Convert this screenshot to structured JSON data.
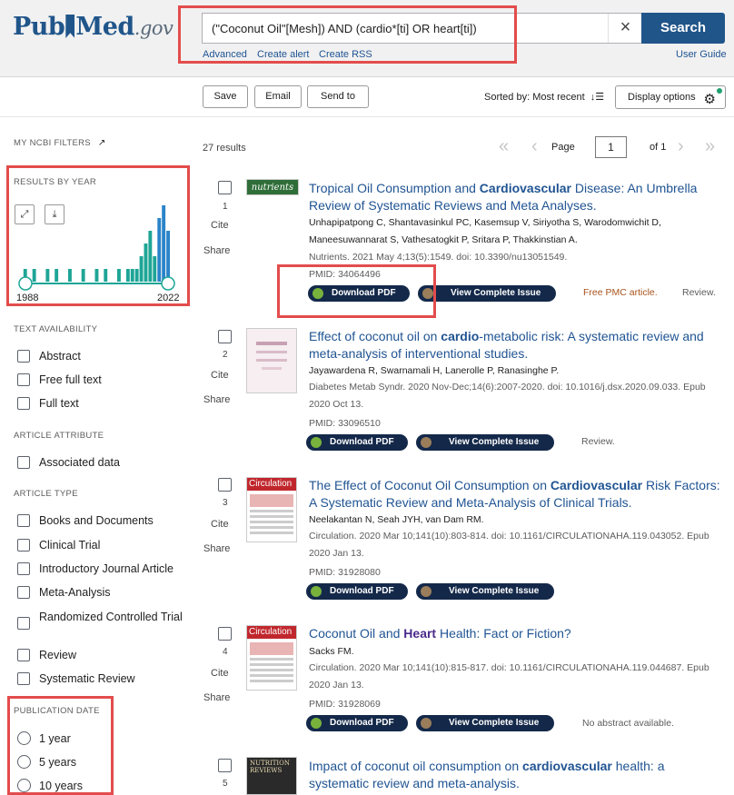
{
  "header": {
    "logo_main_a": "Pub",
    "logo_main_b": "Med",
    "logo_gov": ".gov",
    "query": "(\"Coconut Oil\"[Mesh]) AND (cardio*[ti] OR heart[ti])",
    "clear_icon": "×",
    "search_label": "Search",
    "links": {
      "advanced": "Advanced",
      "create_alert": "Create alert",
      "create_rss": "Create RSS",
      "user_guide": "User Guide"
    }
  },
  "toolbar": {
    "save": "Save",
    "email": "Email",
    "send_to": "Send to",
    "sorted_by": "Sorted by: Most recent",
    "sort_icon": "↓☰",
    "display_options": "Display options",
    "gear_icon": "⚙"
  },
  "sidebar": {
    "my_ncbi_filters": "MY NCBI FILTERS",
    "results_by_year": "RESULTS BY YEAR",
    "expand_icon": "⤢",
    "download_icon": "⤓",
    "year_start": "1988",
    "year_end": "2022",
    "text_availability": {
      "heading": "TEXT AVAILABILITY",
      "items": [
        "Abstract",
        "Free full text",
        "Full text"
      ]
    },
    "article_attribute": {
      "heading": "ARTICLE ATTRIBUTE",
      "items": [
        "Associated data"
      ]
    },
    "article_type": {
      "heading": "ARTICLE TYPE",
      "items": [
        "Books and Documents",
        "Clinical Trial",
        "Introductory Journal Article",
        "Meta-Analysis",
        "Randomized Controlled Trial",
        "Review",
        "Systematic Review"
      ]
    },
    "publication_date": {
      "heading": "PUBLICATION DATE",
      "items": [
        "1 year",
        "5 years",
        "10 years"
      ]
    }
  },
  "chart_data": {
    "type": "bar",
    "title": "RESULTS BY YEAR",
    "x_range": [
      "1988",
      "2022"
    ],
    "values": [
      0,
      0,
      1,
      0,
      1,
      0,
      0,
      1,
      0,
      1,
      0,
      0,
      1,
      0,
      0,
      1,
      0,
      0,
      1,
      0,
      1,
      0,
      0,
      1,
      0,
      1,
      1,
      1,
      2,
      3,
      4,
      2,
      5,
      6,
      4
    ]
  },
  "results": {
    "count": "27 results",
    "page_label": "Page",
    "page_value": "1",
    "of_pages": "of 1",
    "cite": "Cite",
    "share": "Share",
    "download_pdf": "Download PDF",
    "view_issue": "View Complete Issue",
    "items": [
      {
        "num": "1",
        "thumb_label": "nutrients",
        "title_a": "Tropical Oil Consumption and ",
        "title_b": "Cardiovascular",
        "title_c": " Disease: An Umbrella Review of Systematic Reviews and Meta Analyses.",
        "authors": "Unhapipatpong C, Shantavasinkul PC, Kasemsup V, Siriyotha S, Warodomwichit D, Maneesuwannarat S, Vathesatogkit P, Sritara P, Thakkinstian A.",
        "citation": "Nutrients. 2021 May 4;13(5):1549. doi: 10.3390/nu13051549.",
        "pmid": "PMID: 34064496",
        "free_pmc": "Free PMC article.",
        "tag": "Review."
      },
      {
        "num": "2",
        "title_a": "Effect of coconut oil on ",
        "title_b": "cardio",
        "title_c": "-metabolic risk: A systematic review and meta-analysis of interventional studies.",
        "authors": "Jayawardena R, Swarnamali H, Lanerolle P, Ranasinghe P.",
        "citation": "Diabetes Metab Syndr. 2020 Nov-Dec;14(6):2007-2020. doi: 10.1016/j.dsx.2020.09.033. Epub 2020 Oct 13.",
        "pmid": "PMID: 33096510",
        "tag": "Review."
      },
      {
        "num": "3",
        "thumb_label": "Circulation",
        "title_a": "The Effect of Coconut Oil Consumption on ",
        "title_b": "Cardiovascular",
        "title_c": " Risk Factors: A Systematic Review and Meta-Analysis of Clinical Trials.",
        "authors": "Neelakantan N, Seah JYH, van Dam RM.",
        "citation": "Circulation. 2020 Mar 10;141(10):803-814. doi: 10.1161/CIRCULATIONAHA.119.043052. Epub 2020 Jan 13.",
        "pmid": "PMID: 31928080"
      },
      {
        "num": "4",
        "thumb_label": "Circulation",
        "title_a": "Coconut Oil and ",
        "title_b": "Heart",
        "title_c": " Health: Fact or Fiction?",
        "authors": "Sacks FM.",
        "citation": "Circulation. 2020 Mar 10;141(10):815-817. doi: 10.1161/CIRCULATIONAHA.119.044687. Epub 2020 Jan 13.",
        "pmid": "PMID: 31928069",
        "tag": "No abstract available."
      },
      {
        "num": "5",
        "thumb_label": "NUTRITION REVIEWS",
        "title_a": "Impact of coconut oil consumption on ",
        "title_b": "cardiovascular",
        "title_c": " health: a systematic review and meta-analysis."
      }
    ]
  }
}
